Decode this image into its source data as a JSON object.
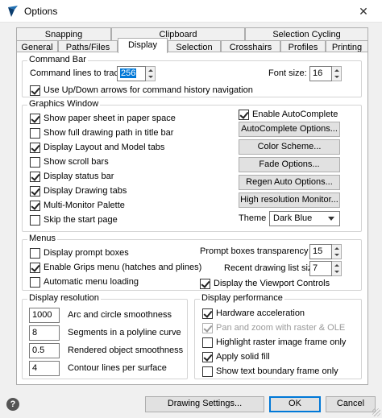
{
  "window": {
    "title": "Options",
    "close": "✕"
  },
  "tabs_row1": [
    "Snapping",
    "Clipboard",
    "Selection Cycling"
  ],
  "tabs_row2": [
    "General",
    "Paths/Files",
    "Display",
    "Selection",
    "Crosshairs",
    "Profiles",
    "Printing"
  ],
  "command_bar": {
    "title": "Command Bar",
    "lines_label": "Command lines to track:",
    "lines_value": "256",
    "font_label": "Font size:",
    "font_value": "16",
    "updown_label": "Use Up/Down arrows for command history navigation"
  },
  "graphics": {
    "title": "Graphics Window",
    "options": [
      {
        "label": "Show paper sheet in paper space",
        "checked": true
      },
      {
        "label": "Show full drawing path in title bar",
        "checked": false
      },
      {
        "label": "Display Layout and Model tabs",
        "checked": true
      },
      {
        "label": "Show scroll bars",
        "checked": false
      },
      {
        "label": "Display status bar",
        "checked": true
      },
      {
        "label": "Display Drawing tabs",
        "checked": true
      },
      {
        "label": "Multi-Monitor Palette",
        "checked": true
      },
      {
        "label": "Skip the start page",
        "checked": false
      }
    ],
    "autocomplete_label": "Enable AutoComplete",
    "buttons": [
      "AutoComplete Options...",
      "Color Scheme...",
      "Fade Options...",
      "Regen Auto Options...",
      "High resolution Monitor..."
    ],
    "theme_label": "Theme",
    "theme_value": "Dark Blue"
  },
  "menus": {
    "title": "Menus",
    "options": [
      {
        "label": "Display prompt boxes",
        "checked": false
      },
      {
        "label": "Enable Grips menu (hatches and plines)",
        "checked": true
      },
      {
        "label": "Automatic menu loading",
        "checked": false
      }
    ],
    "transparency_label": "Prompt boxes transparency (%):",
    "transparency_value": "15",
    "recent_label": "Recent drawing list size:",
    "recent_value": "7",
    "viewport_label": "Display the Viewport Controls"
  },
  "resolution": {
    "title": "Display resolution",
    "rows": [
      {
        "value": "1000",
        "label": "Arc and circle smoothness"
      },
      {
        "value": "8",
        "label": "Segments in a polyline curve"
      },
      {
        "value": "0.5",
        "label": "Rendered object smoothness"
      },
      {
        "value": "4",
        "label": "Contour lines per surface"
      }
    ]
  },
  "performance": {
    "title": "Display performance",
    "options": [
      {
        "label": "Hardware acceleration",
        "checked": true,
        "disabled": false
      },
      {
        "label": "Pan and zoom with raster & OLE",
        "checked": true,
        "disabled": true
      },
      {
        "label": "Highlight raster image frame only",
        "checked": false,
        "disabled": false
      },
      {
        "label": "Apply solid fill",
        "checked": true,
        "disabled": false
      },
      {
        "label": "Show text boundary frame only",
        "checked": false,
        "disabled": false
      }
    ]
  },
  "footer": {
    "help": "?",
    "drawing_settings": "Drawing Settings...",
    "ok": "OK",
    "cancel": "Cancel"
  }
}
